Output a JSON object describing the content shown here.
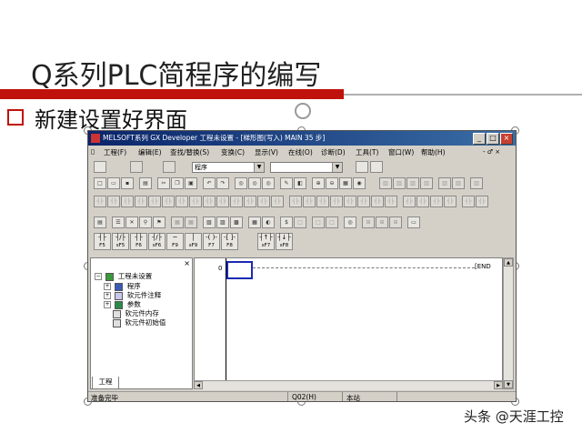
{
  "slide": {
    "title": "Q系列PLC简程序的编写",
    "bullet": "新建设置好界面",
    "watermark": "头条 @天涯工控"
  },
  "window": {
    "title": "MELSOFT系列 GX Developer 工程未设置 - [梯形图(写入)    MAIN    35 步]",
    "minimize": "_",
    "maximize": "□",
    "close": "×"
  },
  "menu": {
    "items": [
      "工程(F)",
      "编辑(E)",
      "查找/替换(S)",
      "变换(C)",
      "显示(V)",
      "在线(O)",
      "诊断(D)",
      "工具(T)",
      "窗口(W)",
      "帮助(H)"
    ],
    "mdi_controls": "- ♂ ×"
  },
  "toolbar": {
    "program_combo": "程序",
    "device_combo": ""
  },
  "ladder_buttons": [
    {
      "sym": "┤├",
      "key": "F5"
    },
    {
      "sym": "┤/├",
      "key": "sF5"
    },
    {
      "sym": "┤├",
      "key": "F6"
    },
    {
      "sym": "┤/├",
      "key": "sF6"
    },
    {
      "sym": "─",
      "key": "F9"
    },
    {
      "sym": "│",
      "key": "sF9"
    },
    {
      "sym": "-( )-",
      "key": "F7"
    },
    {
      "sym": "-[ ]-",
      "key": "F8"
    },
    {
      "sym": "┤↑├",
      "key": "sF7"
    },
    {
      "sym": "┤↓├",
      "key": "sF8"
    }
  ],
  "project_tree": {
    "root": "工程未设置",
    "items": [
      "程序",
      "软元件注释",
      "参数",
      "软元件内存",
      "软元件初始值"
    ],
    "tab": "工程"
  },
  "editor": {
    "step": "0",
    "end": "END"
  },
  "status": {
    "ready": "准备完毕",
    "cpu": "Q02(H)",
    "station": "本站"
  },
  "colors": {
    "title_rule": "#c0120c",
    "titlebar": "#0a246a",
    "cursor": "#1b2bb0"
  }
}
